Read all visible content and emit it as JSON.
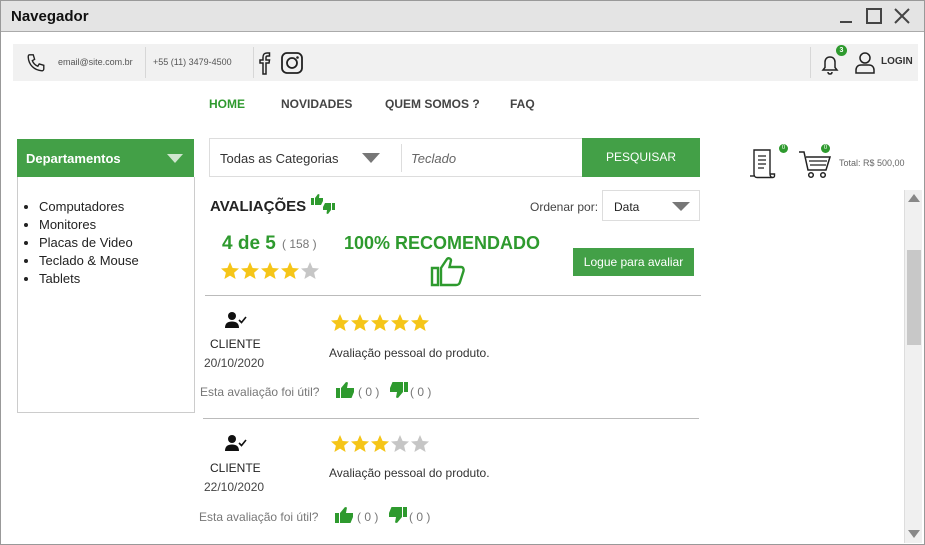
{
  "window": {
    "title": "Navegador"
  },
  "contact": {
    "email": "email@site.com.br",
    "phone": "+55 (11) 3479-4500"
  },
  "header": {
    "notification_count": "3",
    "login_label": "LOGIN"
  },
  "nav": {
    "items": [
      "HOME",
      "NOVIDADES",
      "QUEM SOMOS ?",
      "FAQ"
    ]
  },
  "departments": {
    "title": "Departamentos",
    "items": [
      "Computadores",
      "Monitores",
      "Placas de Video",
      "Teclado & Mouse",
      "Tablets"
    ]
  },
  "search": {
    "category": "Todas as Categorias",
    "placeholder": "Teclado",
    "button": "PESQUISAR"
  },
  "cart": {
    "list_count": "0",
    "cart_count": "0",
    "total": "Total: R$ 500,00"
  },
  "reviews": {
    "title": "AVALIAÇÕES",
    "sort_label": "Ordenar por:",
    "sort_value": "Data",
    "score": "4 de 5",
    "count": "( 158 )",
    "score_stars": 4,
    "recommend": "100% RECOMENDADO",
    "login_button": "Logue para avaliar",
    "helpful_label": "Esta avaliação foi útil?",
    "items": [
      {
        "author": "CLIENTE",
        "date": "20/10/2020",
        "stars": 5,
        "text": "Avaliação pessoal do produto.",
        "up": "( 0 )",
        "down": "( 0 )"
      },
      {
        "author": "CLIENTE",
        "date": "22/10/2020",
        "stars": 3,
        "text": "Avaliação pessoal do produto.",
        "up": "( 0 )",
        "down": "( 0 )"
      }
    ]
  },
  "colors": {
    "accent": "#43a047",
    "star": "#f5c518",
    "star_empty": "#c6c6c6"
  }
}
